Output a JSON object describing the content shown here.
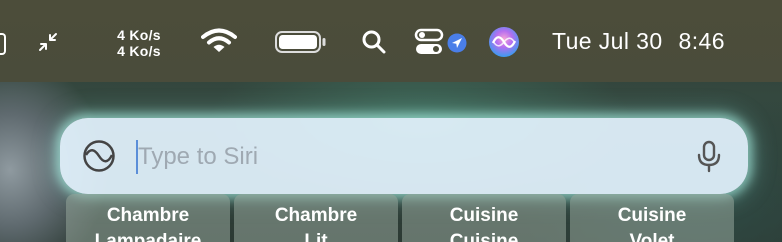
{
  "menubar": {
    "network_up": "4 Ko/s",
    "network_down": "4 Ko/s",
    "date": "Tue Jul 30",
    "time": "8:46",
    "icons": [
      "window-edge-icon",
      "fullscreen-collapse-icon",
      "wifi-icon",
      "battery-icon",
      "spotlight-search-icon",
      "control-center-icon",
      "location-arrow-icon",
      "siri-icon"
    ]
  },
  "siri": {
    "placeholder": "Type to Siri",
    "value": "",
    "icons": [
      "siri-icon",
      "microphone-icon"
    ]
  },
  "suggestions": [
    {
      "title": "Chambre",
      "subtitle": "Lampadaire"
    },
    {
      "title": "Chambre",
      "subtitle": "Lit"
    },
    {
      "title": "Cuisine",
      "subtitle": "Cuisine"
    },
    {
      "title": "Cuisine",
      "subtitle": "Volet"
    }
  ],
  "colors": {
    "menubar": "#4b4c3a",
    "siri_field": "#e4f4ff",
    "location_badge": "#4a7ee8"
  }
}
